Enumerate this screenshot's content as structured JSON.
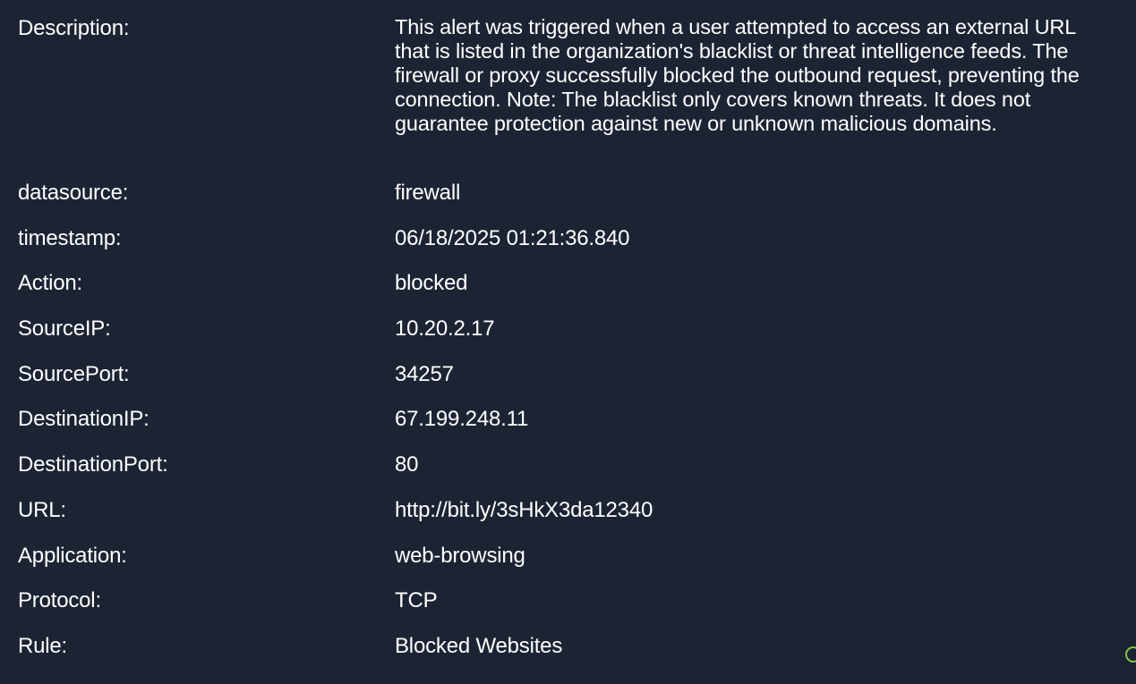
{
  "alert": {
    "description": {
      "label": "Description:",
      "value": "This alert was triggered when a user attempted to access an external URL that is listed in the organization's blacklist or threat intelligence feeds. The firewall or proxy successfully blocked the outbound request, preventing the connection. Note: The blacklist only covers known threats. It does not guarantee protection against new or unknown malicious domains."
    },
    "fields": [
      {
        "label": "datasource:",
        "value": "firewall"
      },
      {
        "label": "timestamp:",
        "value": "06/18/2025 01:21:36.840"
      },
      {
        "label": "Action:",
        "value": "blocked"
      },
      {
        "label": "SourceIP:",
        "value": "10.20.2.17"
      },
      {
        "label": "SourcePort:",
        "value": "34257"
      },
      {
        "label": "DestinationIP:",
        "value": "67.199.248.11"
      },
      {
        "label": "DestinationPort:",
        "value": "80"
      },
      {
        "label": "URL:",
        "value": "http://bit.ly/3sHkX3da12340"
      },
      {
        "label": "Application:",
        "value": "web-browsing"
      },
      {
        "label": "Protocol:",
        "value": "TCP"
      },
      {
        "label": "Rule:",
        "value": "Blocked Websites"
      }
    ]
  },
  "colors": {
    "background": "#1c2434",
    "text": "#ffffff",
    "corner_icon": "#8bc34a"
  },
  "icons": {
    "corner": "status-circle-icon"
  }
}
